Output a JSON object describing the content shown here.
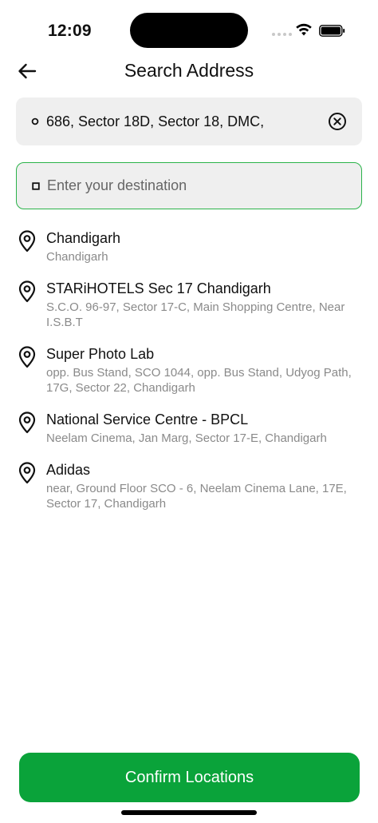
{
  "status_bar": {
    "time": "12:09"
  },
  "header": {
    "title": "Search Address",
    "back_icon": "arrow-left-icon"
  },
  "origin": {
    "value": "686, Sector 18D, Sector 18, DMC,",
    "icon": "circle-dot-icon",
    "clear_icon": "clear-circle-icon"
  },
  "destination": {
    "placeholder": "Enter your destination",
    "icon": "square-dot-icon",
    "focus_color": "#2bb34a"
  },
  "results": [
    {
      "name": "Chandigarh",
      "address": "Chandigarh"
    },
    {
      "name": "STARiHOTELS Sec 17 Chandigarh",
      "address": "S.C.O. 96-97, Sector 17-C, Main Shopping Centre, Near I.S.B.T"
    },
    {
      "name": "Super Photo Lab",
      "address": "opp. Bus Stand, SCO 1044, opp. Bus Stand, Udyog Path, 17G, Sector 22, Chandigarh"
    },
    {
      "name": "National Service Centre - BPCL",
      "address": "Neelam Cinema, Jan Marg, Sector 17-E, Chandigarh"
    },
    {
      "name": "Adidas",
      "address": "near, Ground Floor SCO - 6, Neelam Cinema Lane, 17E, Sector 17, Chandigarh"
    }
  ],
  "confirm": {
    "label": "Confirm Locations",
    "color": "#0aa33a"
  }
}
